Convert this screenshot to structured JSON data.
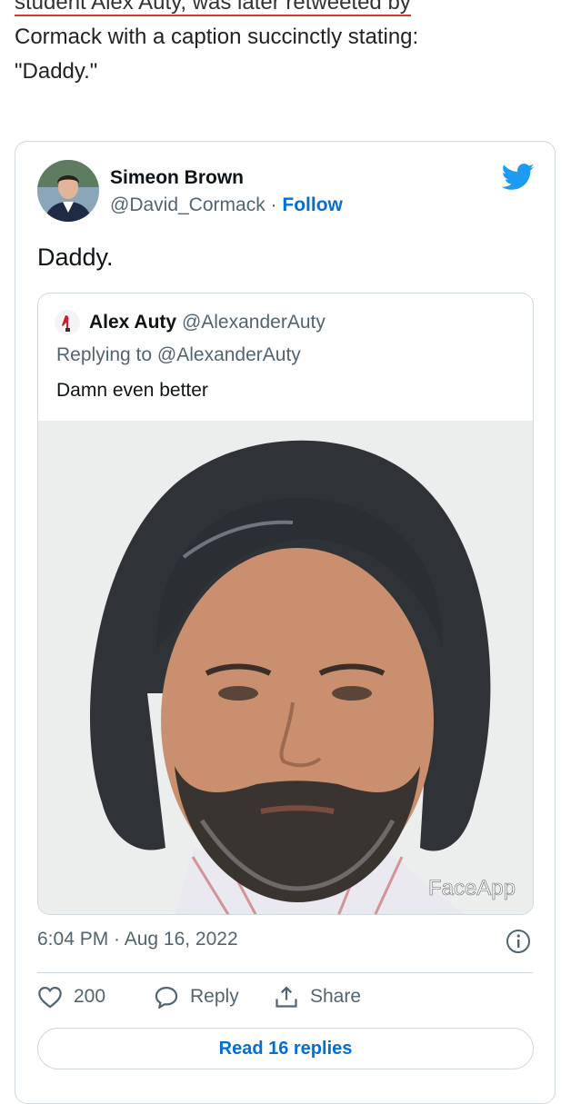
{
  "article": {
    "line1": "student Alex Auty, was later retweeted by",
    "line2": "Cormack with a caption succinctly stating:",
    "line3": "\"Daddy.\""
  },
  "tweet": {
    "author_name": "Simeon Brown",
    "author_handle": "@David_Cormack",
    "separator": "·",
    "follow_label": "Follow",
    "text": "Daddy.",
    "timestamp": "6:04 PM · Aug 16, 2022",
    "like_count": "200",
    "reply_label": "Reply",
    "share_label": "Share",
    "read_replies_label": "Read 16 replies",
    "icons": {
      "brand": "twitter-bird-icon",
      "info": "info-icon",
      "like": "heart-icon",
      "reply": "speech-bubble-icon",
      "share": "share-arrow-icon"
    }
  },
  "quoted_tweet": {
    "author_name": "Alex Auty",
    "author_handle": "@AlexanderAuty",
    "replying_to": "Replying to @AlexanderAuty",
    "text": "Damn even better",
    "media_watermark": "FaceApp"
  },
  "colors": {
    "twitter_blue": "#1d9bf0",
    "link_blue": "#006fd6",
    "secondary_text": "#536471",
    "border": "#cfd9de",
    "spellcheck_red": "#dd3333"
  }
}
